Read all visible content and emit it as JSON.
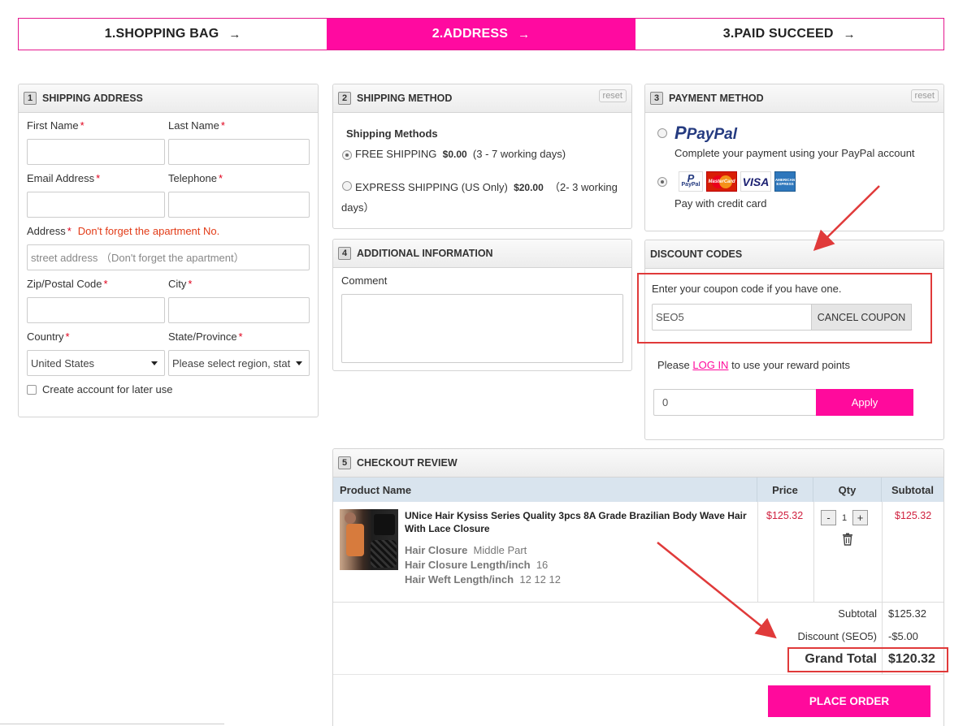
{
  "steps": [
    {
      "label": "1.SHOPPING BAG",
      "arrow": "→"
    },
    {
      "label": "2.ADDRESS",
      "arrow": "→"
    },
    {
      "label": "3.PAID SUCCEED",
      "arrow": "→"
    }
  ],
  "shipping_address": {
    "num": "1",
    "title": "SHIPPING ADDRESS",
    "first_name": "First Name",
    "last_name": "Last Name",
    "email": "Email Address",
    "telephone": "Telephone",
    "address": "Address",
    "address_hint": "Don't forget the apartment No.",
    "address_placeholder": "street address （Don't forget the apartment）",
    "zip": "Zip/Postal Code",
    "city": "City",
    "country": "Country",
    "state": "State/Province",
    "country_value": "United States",
    "state_value": "Please select region, stat",
    "create_account": "Create account for later use",
    "req": "*"
  },
  "shipping_method": {
    "num": "2",
    "title": "SHIPPING METHOD",
    "reset": "reset",
    "heading": "Shipping Methods",
    "free_label": "FREE SHIPPING",
    "free_price": "$0.00",
    "free_days": "(3 - 7 working days)",
    "express_label": "EXPRESS SHIPPING (US Only)",
    "express_price": "$20.00",
    "express_days_1": "（2- 3 working",
    "express_days_2": "days）"
  },
  "additional": {
    "num": "4",
    "title": "ADDITIONAL INFORMATION",
    "comment": "Comment"
  },
  "payment": {
    "num": "3",
    "title": "PAYMENT METHOD",
    "reset": "reset",
    "paypal_logo": "PayPal",
    "paypal_desc": "Complete your payment using your PayPal account",
    "card_paypal": "PayPal",
    "card_mc": "MasterCard",
    "card_visa": "VISA",
    "card_amex": "AMERICAN EXPRESS",
    "card_desc": "Pay with credit card"
  },
  "discount": {
    "title": "DISCOUNT CODES",
    "prompt": "Enter your coupon code if you have one.",
    "code": "SEO5",
    "cancel": "CANCEL COUPON",
    "reward_pre": "Please ",
    "reward_link": "LOG IN",
    "reward_post": " to use your reward points",
    "points": "0",
    "apply": "Apply"
  },
  "review": {
    "num": "5",
    "title": "CHECKOUT REVIEW",
    "headers": {
      "product": "Product Name",
      "price": "Price",
      "qty": "Qty",
      "subtotal": "Subtotal"
    },
    "item": {
      "name_1": "UNice Hair Kysiss Series Quality 3pcs 8A Grade Brazilian Body Wave Hair",
      "name_2": "With Lace Closure",
      "price": "$125.32",
      "qty": "1",
      "minus": "-",
      "plus": "+",
      "subtotal": "$125.32",
      "opts": [
        {
          "k": "Hair Closure",
          "v": "Middle Part"
        },
        {
          "k": "Hair Closure Length/inch",
          "v": "16"
        },
        {
          "k": "Hair Weft Length/inch",
          "v": "12 12 12"
        }
      ]
    },
    "subtotal_label": "Subtotal",
    "subtotal_value": "$125.32",
    "discount_label": "Discount (SEO5)",
    "discount_value": "-$5.00",
    "grand_label": "Grand Total",
    "grand_value": "$120.32",
    "place_order": "PLACE ORDER"
  },
  "colors": {
    "brand_pink": "#ff0a9c",
    "annotation_red": "#e03a3a",
    "price_red": "#d0213f"
  }
}
